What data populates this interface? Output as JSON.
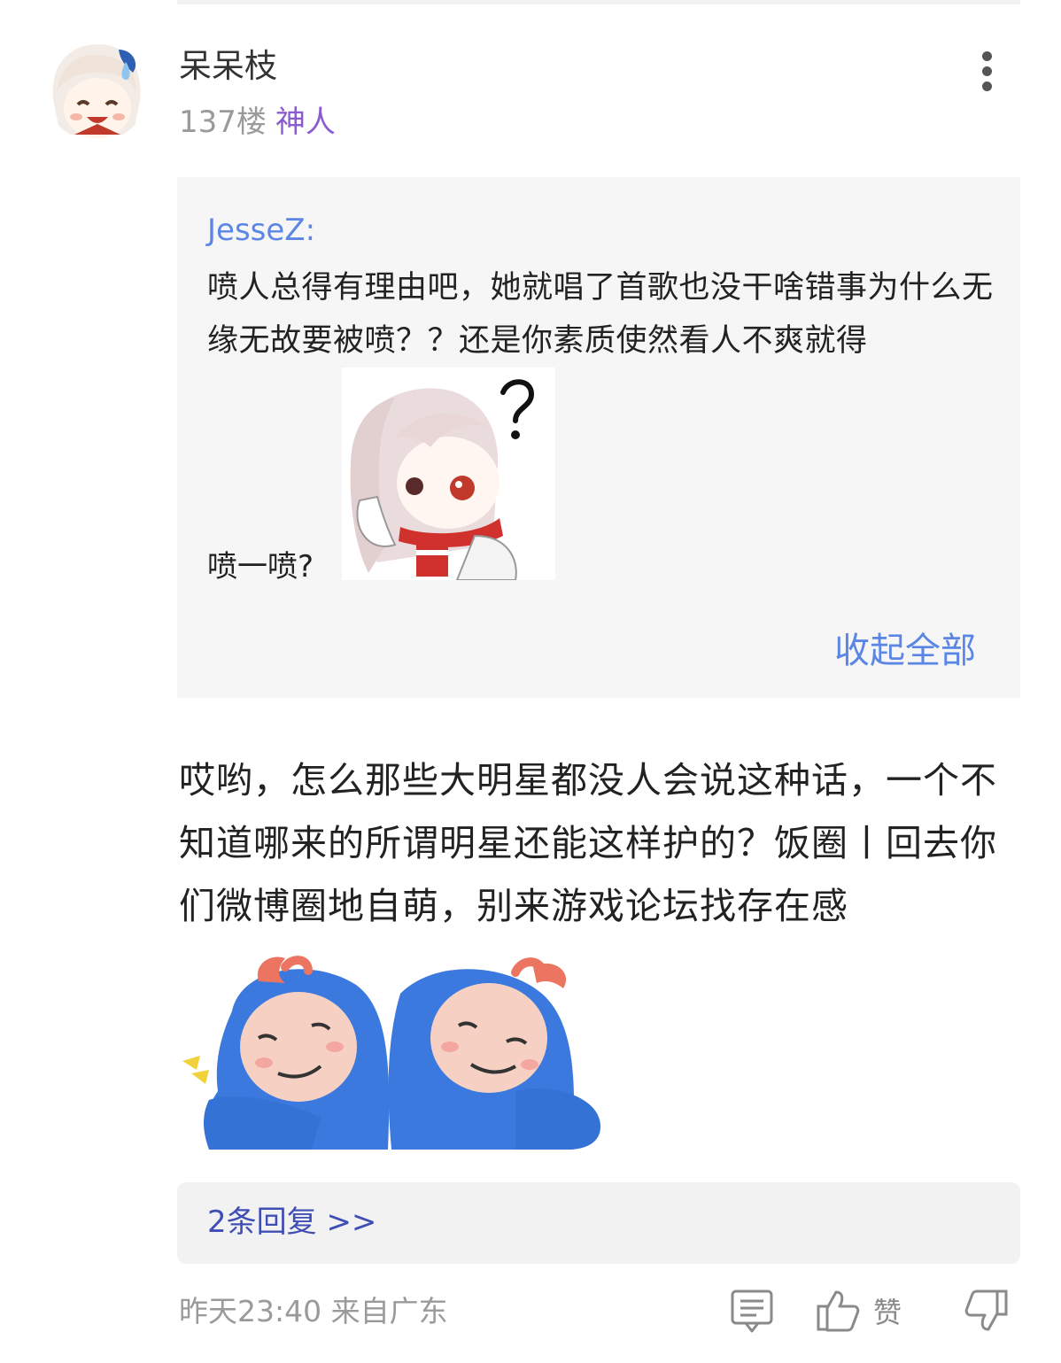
{
  "post": {
    "username": "呆呆枝",
    "floor": "137楼",
    "badge": "神人",
    "quote": {
      "author": "JesseZ:",
      "text": "喷人总得有理由吧，她就唱了首歌也没干啥错事为什么无缘无故要被喷？？还是你素质使然看人不爽就得",
      "tail": "喷一喷?",
      "collapse_label": "收起全部"
    },
    "content": "哎哟，怎么那些大明星都没人会说这种话，一个不知道哪来的所谓明星还能这样护的？饭圈丨回去你们微博圈地自萌，别来游戏论坛找存在感",
    "replies_label": "2条回复 >>",
    "timestamp": "昨天23:40 来自广东",
    "like_label": "赞"
  },
  "icons": {
    "more": "more-vertical-icon",
    "comment": "comment-icon",
    "like": "thumbs-up-icon",
    "dislike": "thumbs-down-icon"
  },
  "colors": {
    "link_blue": "#5b86e5",
    "badge_purple": "#8a5cd0",
    "reply_link": "#3f4eb5",
    "quote_bg": "#f6f6f6",
    "muted": "#9a9a9a"
  }
}
